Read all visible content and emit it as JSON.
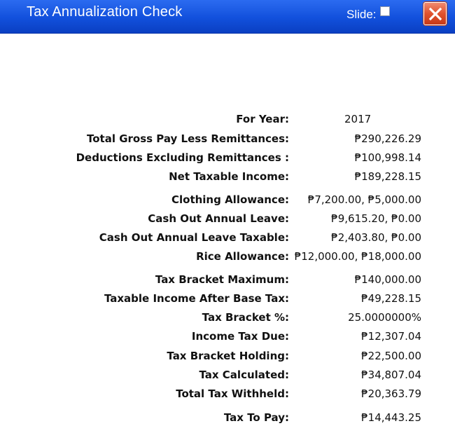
{
  "window": {
    "title": "Tax Annualization Check",
    "slide_label": "Slide:",
    "slide_checked": false
  },
  "rows": [
    {
      "label": "For Year:",
      "value": "2017"
    },
    {
      "label": "Total Gross Pay Less Remittances:",
      "value": "₱290,226.29"
    },
    {
      "label": "Deductions Excluding Remittances :",
      "value": "₱100,998.14"
    },
    {
      "label": "Net Taxable Income:",
      "value": "₱189,228.15"
    },
    {
      "label": "Clothing Allowance:",
      "value": "₱7,200.00, ₱5,000.00"
    },
    {
      "label": "Cash Out Annual Leave:",
      "value": "₱9,615.20, ₱0.00"
    },
    {
      "label": "Cash Out Annual Leave Taxable:",
      "value": "₱2,403.80, ₱0.00"
    },
    {
      "label": "Rice Allowance:",
      "value": "₱12,000.00, ₱18,000.00"
    },
    {
      "label": "Tax Bracket Maximum:",
      "value": "₱140,000.00"
    },
    {
      "label": "Taxable Income After Base Tax:",
      "value": "₱49,228.15"
    },
    {
      "label": "Tax Bracket %:",
      "value": "25.0000000%"
    },
    {
      "label": "Income Tax Due:",
      "value": "₱12,307.04"
    },
    {
      "label": "Tax Bracket Holding:",
      "value": "₱22,500.00"
    },
    {
      "label": "Tax Calculated:",
      "value": "₱34,807.04"
    },
    {
      "label": "Total Tax Withheld:",
      "value": "₱20,363.79"
    },
    {
      "label": "Tax To Pay:",
      "value": "₱14,443.25"
    }
  ]
}
